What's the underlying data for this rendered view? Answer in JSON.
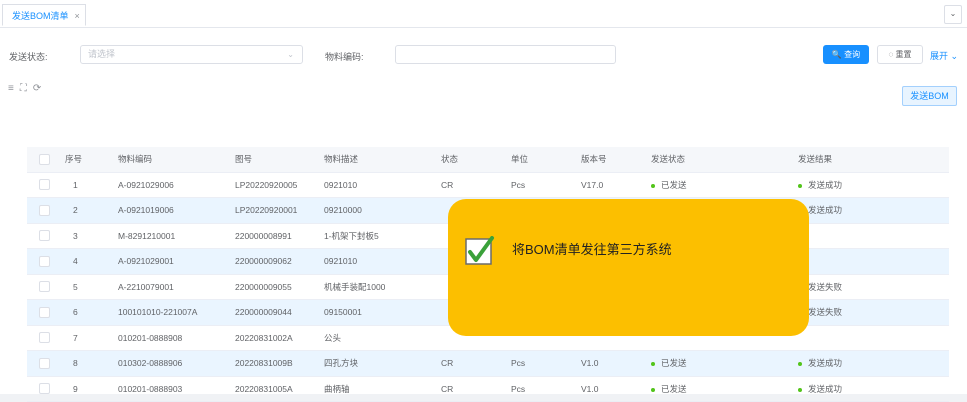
{
  "tabs": [
    {
      "label": "发送BOM清单",
      "close": "×"
    }
  ],
  "tab_collapse": "⌄",
  "filters": {
    "status_label": "发送状态:",
    "status_placeholder": "请选择",
    "code_label": "物料编码:",
    "code_value": ""
  },
  "buttons": {
    "search": "🔍 查询",
    "reset": "◌ 重置",
    "expand": "展开 ⌄",
    "send_bom": "发送BOM"
  },
  "toolbar_icons": [
    "sort-icon",
    "fullscreen-icon",
    "refresh-icon"
  ],
  "columns": [
    "序号",
    "物料编码",
    "图号",
    "物料描述",
    "状态",
    "单位",
    "版本号",
    "发送状态",
    "发送结果"
  ],
  "rows": [
    {
      "no": "1",
      "code": "A-0921029006",
      "drawing": "LP20220920005",
      "desc": "0921010",
      "status": "CR",
      "unit": "Pcs",
      "version": "V17.0",
      "send_status": "已发送",
      "result": "发送成功"
    },
    {
      "no": "2",
      "code": "A-0921019006",
      "drawing": "LP20220920001",
      "desc": "09210000",
      "status": "",
      "unit": "",
      "version": "",
      "send_status": "",
      "result": "发送成功"
    },
    {
      "no": "3",
      "code": "M-8291210001",
      "drawing": "220000008991",
      "desc": "1-机架下封板5",
      "status": "",
      "unit": "",
      "version": "",
      "send_status": "",
      "result": ""
    },
    {
      "no": "4",
      "code": "A-0921029001",
      "drawing": "220000009062",
      "desc": "0921010",
      "status": "",
      "unit": "",
      "version": "",
      "send_status": "",
      "result": ""
    },
    {
      "no": "5",
      "code": "A-2210079001",
      "drawing": "220000009055",
      "desc": "机械手装配1000",
      "status": "",
      "unit": "",
      "version": "",
      "send_status": "",
      "result": "发送失败"
    },
    {
      "no": "6",
      "code": "100101010-221007A",
      "drawing": "220000009044",
      "desc": "09150001",
      "status": "",
      "unit": "",
      "version": "",
      "send_status": "",
      "result": "发送失败"
    },
    {
      "no": "7",
      "code": "010201-0888908",
      "drawing": "20220831002A",
      "desc": "公头",
      "status": "",
      "unit": "",
      "version": "",
      "send_status": "",
      "result": ""
    },
    {
      "no": "8",
      "code": "010302-0888906",
      "drawing": "20220831009B",
      "desc": "四孔方块",
      "status": "CR",
      "unit": "Pcs",
      "version": "V1.0",
      "send_status": "已发送",
      "result": "发送成功"
    },
    {
      "no": "9",
      "code": "010201-0888903",
      "drawing": "20220831005A",
      "desc": "曲柄轴",
      "status": "CR",
      "unit": "Pcs",
      "version": "V1.0",
      "send_status": "已发送",
      "result": "发送成功"
    }
  ],
  "status_colors": {
    "success": "#52c41a",
    "failure": "#f5222d"
  },
  "toast": {
    "message": "将BOM清单发往第三方系统",
    "icon": "checkbox-checked-icon",
    "color": "#fcbf00"
  }
}
